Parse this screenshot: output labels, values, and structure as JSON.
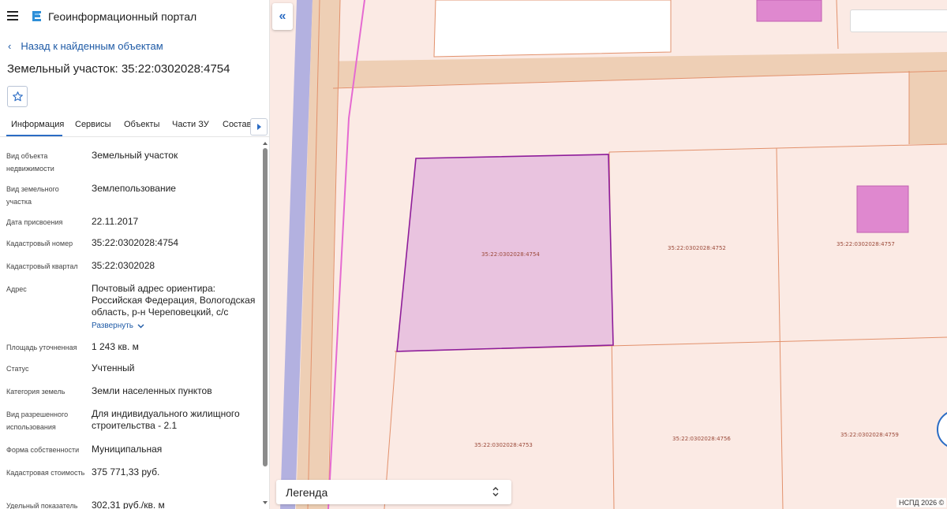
{
  "header": {
    "app_title": "Геоинформационный портал",
    "menu_icon": "menu-icon",
    "logo_icon": "portal-logo-icon"
  },
  "back_link": "Назад к найденным объектам",
  "object_title": "Земельный участок: 35:22:0302028:4754",
  "favorite_icon": "star-icon",
  "tabs": [
    {
      "label": "Информация",
      "active": true
    },
    {
      "label": "Сервисы"
    },
    {
      "label": "Объекты"
    },
    {
      "label": "Части ЗУ"
    },
    {
      "label": "Состав"
    }
  ],
  "attributes": [
    {
      "label": "Вид объекта недвижимости",
      "value": "Земельный участок"
    },
    {
      "label": "Вид земельного участка",
      "value": "Землепользование"
    },
    {
      "label": "Дата присвоения",
      "value": "22.11.2017"
    },
    {
      "label": "Кадастровый номер",
      "value": "35:22:0302028:4754"
    },
    {
      "label": "Кадастровый квартал",
      "value": "35:22:0302028"
    },
    {
      "label": "Адрес",
      "value": "Почтовый адрес ориентира: Российская Федерация, Вологодская область, р-н Череповецкий, с/с",
      "link": "Развернуть"
    },
    {
      "label": "Площадь уточненная",
      "value": "1 243 кв. м"
    },
    {
      "label": "Статус",
      "value": "Учтенный"
    },
    {
      "label": "Категория земель",
      "value": "Земли населенных пунктов"
    },
    {
      "label": "Вид разрешенного использования",
      "value": "Для индивидуального жилищного строительства - 2.1"
    },
    {
      "label": "Форма собственности",
      "value": "Муниципальная"
    },
    {
      "label": "Кадастровая стоимость",
      "value": "375 771,33 руб."
    },
    {
      "label": "Удельный показатель",
      "value": "302,31 руб./кв. м"
    }
  ],
  "map": {
    "parcels": [
      {
        "id": "35:22:0302028:4754",
        "selected": true
      },
      {
        "id": "35:22:0302028:4752"
      },
      {
        "id": "35:22:0302028:4757"
      },
      {
        "id": "35:22:0302028:4753"
      },
      {
        "id": "35:22:0302028:4756"
      },
      {
        "id": "35:22:0302028:4759"
      }
    ],
    "colors": {
      "background": "#fbeae4",
      "road": "#eecfb5",
      "parcel_border": "#e2916c",
      "selected_fill": "#e9c3df",
      "selected_border": "#8e1d9a",
      "building": "#df88cf",
      "river": "#b3b1e0"
    },
    "legend_label": "Легенда",
    "copyright": "НСПД 2026 ©",
    "collapse_icon": "double-chevron-left-icon"
  }
}
